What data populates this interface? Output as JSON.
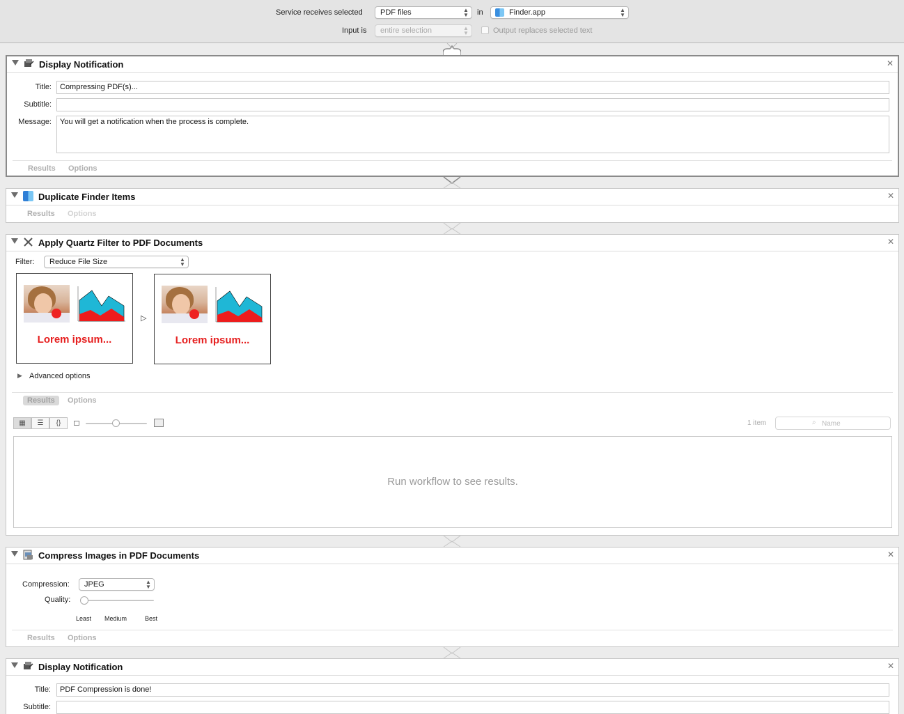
{
  "topbar": {
    "service_label": "Service receives selected",
    "service_value": "PDF files",
    "in_label": "in",
    "app_value": "Finder.app",
    "input_label": "Input is",
    "input_value": "entire selection",
    "output_replaces_label": "Output replaces selected text",
    "output_replaces_checked": false
  },
  "actions": {
    "notify1": {
      "title": "Display Notification",
      "title_label": "Title:",
      "title_value": "Compressing PDF(s)...",
      "subtitle_label": "Subtitle:",
      "subtitle_value": "",
      "message_label": "Message:",
      "message_value": "You will get a notification when the process is complete.",
      "results": "Results",
      "options": "Options"
    },
    "duplicate": {
      "title": "Duplicate Finder Items",
      "results": "Results",
      "options": "Options"
    },
    "quartz": {
      "title": "Apply Quartz Filter to PDF Documents",
      "filter_label": "Filter:",
      "filter_value": "Reduce File Size",
      "thumb_text_before": "Lorem ipsum...",
      "thumb_text_after": "Lorem ipsum...",
      "advanced": "Advanced options",
      "results": "Results",
      "options": "Options",
      "item_count": "1 item",
      "search_placeholder": "Name",
      "empty_message": "Run workflow to see results."
    },
    "compress": {
      "title": "Compress Images in PDF Documents",
      "compression_label": "Compression:",
      "compression_value": "JPEG",
      "quality_label": "Quality:",
      "quality_level": 0,
      "tick_least": "Least",
      "tick_medium": "Medium",
      "tick_best": "Best",
      "results": "Results",
      "options": "Options"
    },
    "notify2": {
      "title": "Display Notification",
      "title_label": "Title:",
      "title_value": "PDF Compression is done!",
      "subtitle_label": "Subtitle:",
      "subtitle_value": ""
    }
  },
  "colors": {
    "lorem_red": "#e62020",
    "chart_cyan": "#1fb7d6",
    "chart_red": "#ee1c1c"
  }
}
